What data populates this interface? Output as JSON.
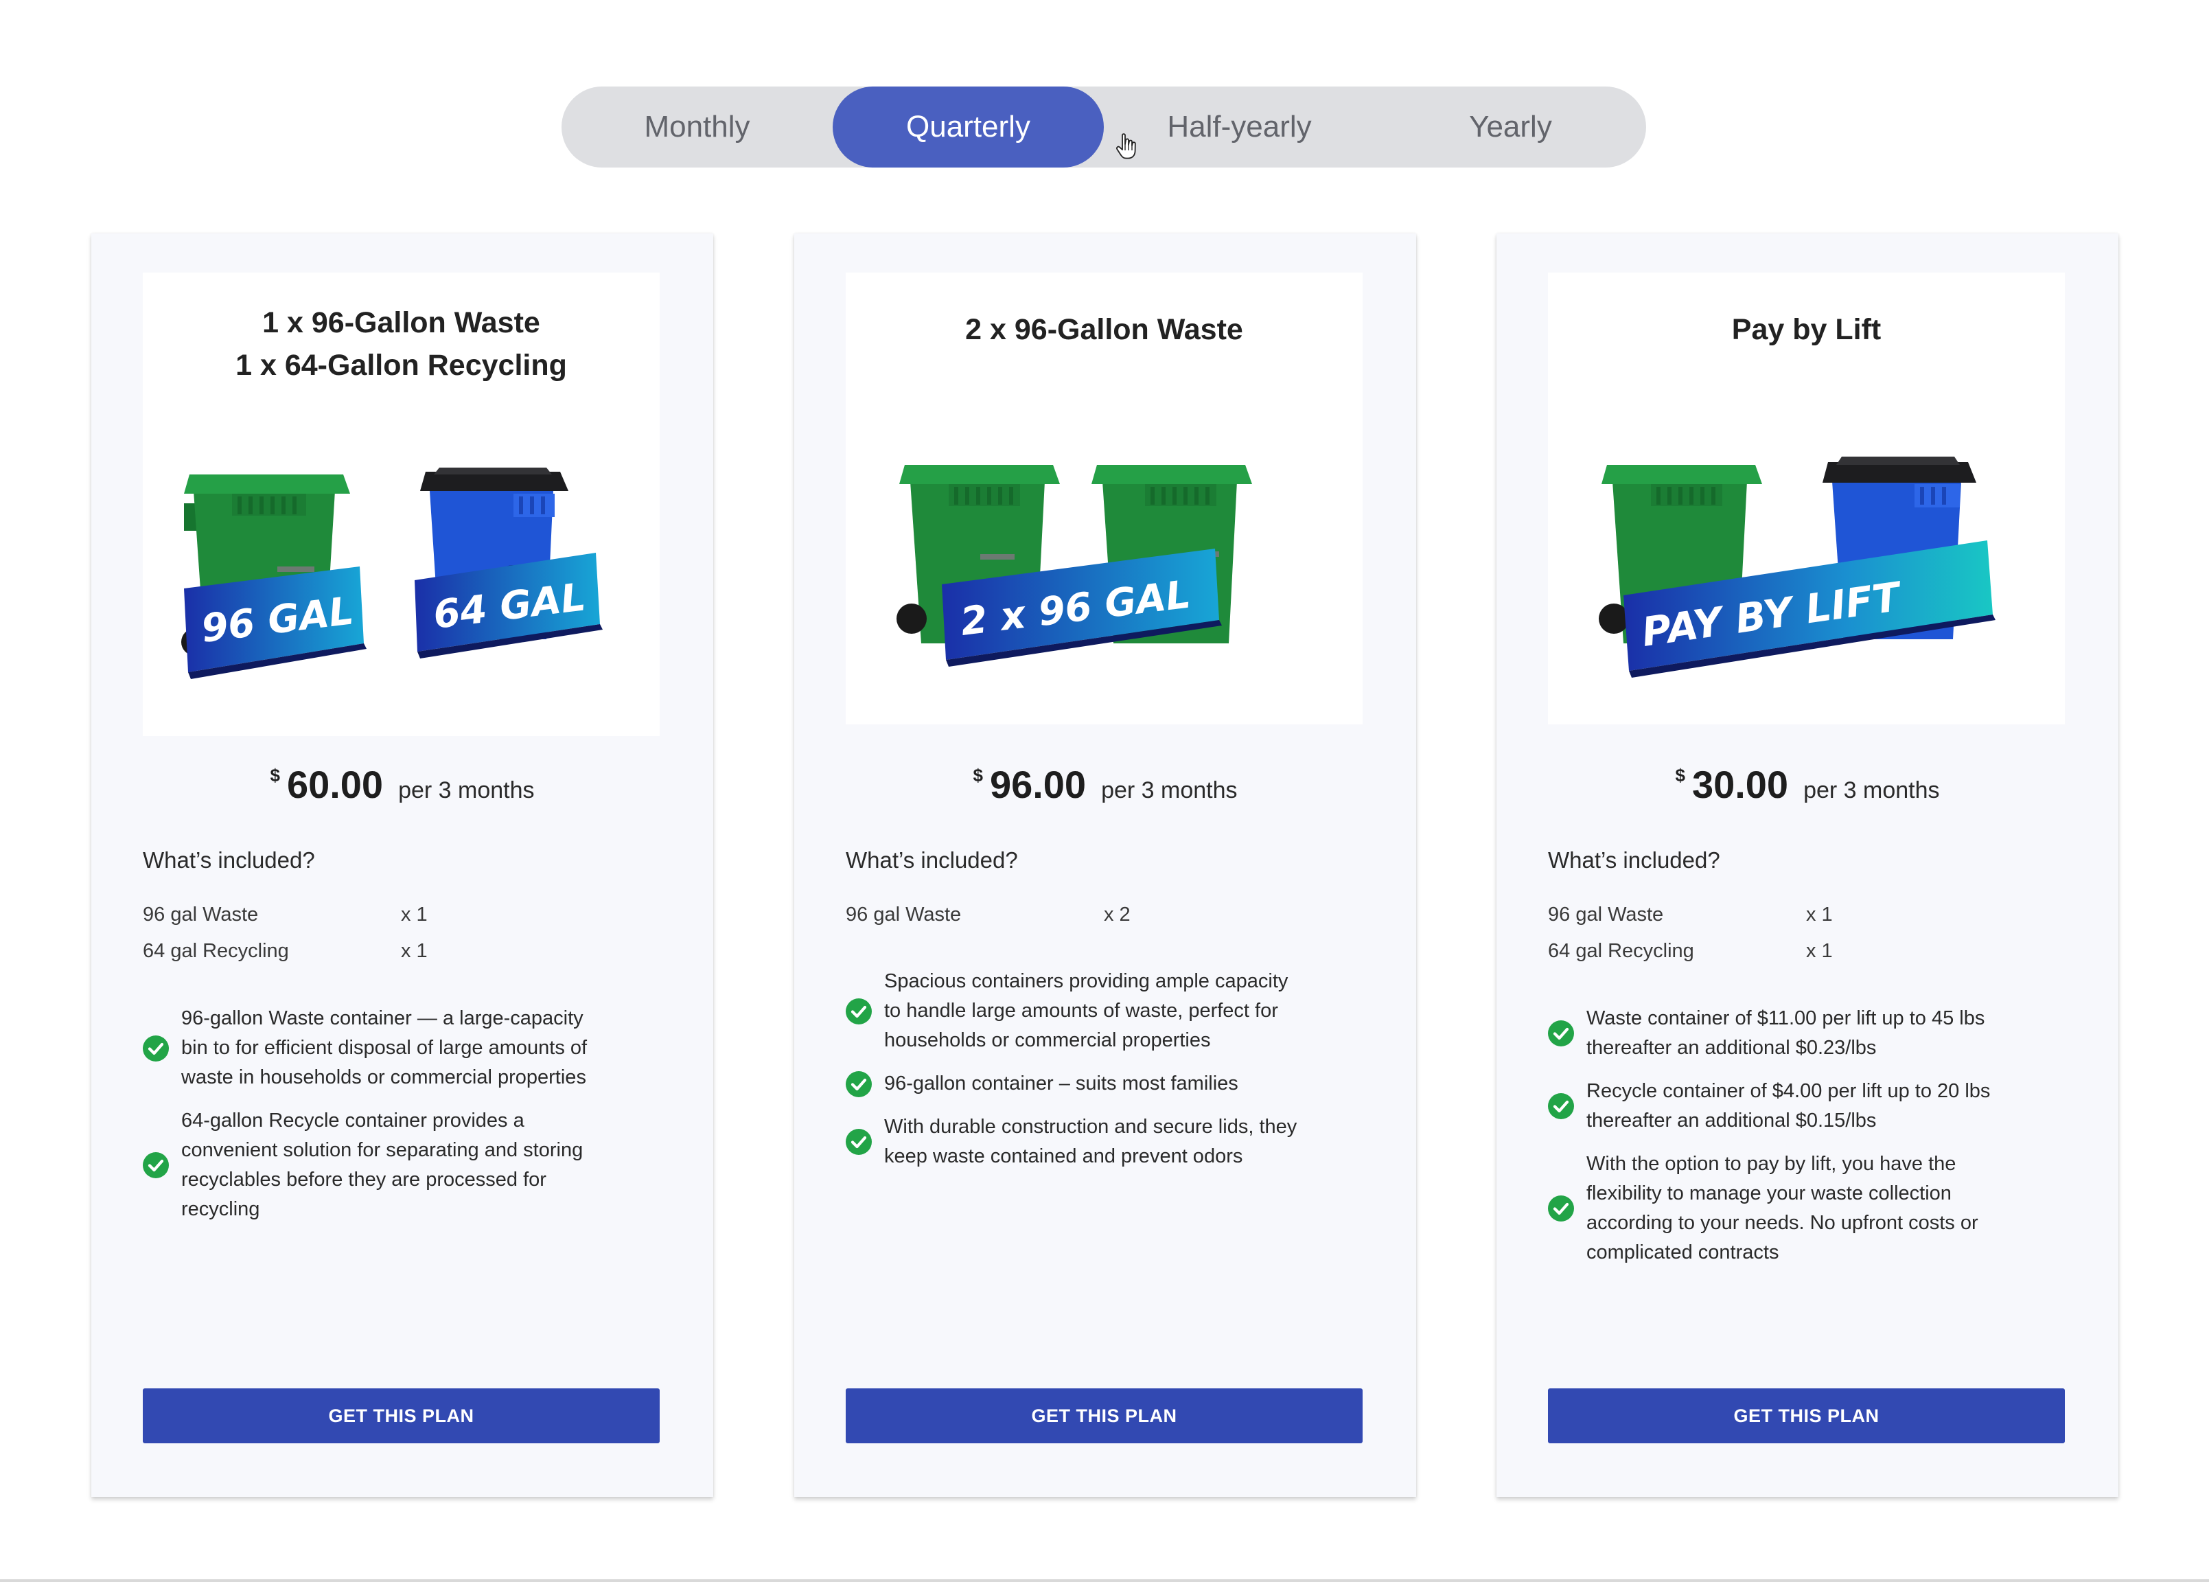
{
  "billing_toggle": {
    "options": [
      "Monthly",
      "Quarterly",
      "Half-yearly",
      "Yearly"
    ],
    "selected": "Quarterly"
  },
  "colors": {
    "accent": "#4a60c0",
    "button": "#3249b2",
    "toggle_bg": "#dedfe2",
    "check": "#22a447",
    "bin_green": "#1f8a3a",
    "bin_blue": "#1f55d6"
  },
  "plans": [
    {
      "title_line1": "1 x 96-Gallon Waste",
      "title_line2": "1 x 64-Gallon Recycling",
      "image_labels": [
        "96 GAL",
        "64 GAL"
      ],
      "currency": "$",
      "price": "60.00",
      "period": "per 3 months",
      "included_heading": "What’s included?",
      "quantities": [
        {
          "name": "96 gal Waste",
          "qty": "x 1"
        },
        {
          "name": "64 gal Recycling",
          "qty": "x 1"
        }
      ],
      "features": [
        {
          "line1": "96-gallon Waste container — a large-capacity",
          "line2": "bin to for efficient disposal of large amounts of",
          "line3": "waste in households or commercial properties",
          "line4": ""
        },
        {
          "line1": "64-gallon Recycle container provides a",
          "line2": "convenient solution for separating and storing",
          "line3": "recyclables before they are processed for",
          "line4": "recycling"
        }
      ],
      "cta": "GET THIS PLAN"
    },
    {
      "title_line1": "2 x 96-Gallon Waste",
      "title_line2": "",
      "image_labels": [
        "2 x 96 GAL"
      ],
      "currency": "$",
      "price": "96.00",
      "period": "per 3 months",
      "included_heading": "What’s included?",
      "quantities": [
        {
          "name": "96 gal Waste",
          "qty": "x 2"
        }
      ],
      "features": [
        {
          "line1": "Spacious containers providing ample capacity",
          "line2": "to handle large amounts of waste, perfect for",
          "line3": "households or commercial properties",
          "line4": ""
        },
        {
          "line1": "96-gallon container – suits most families",
          "line2": "",
          "line3": "",
          "line4": ""
        },
        {
          "line1": "With durable construction and secure lids, they",
          "line2": "keep waste contained and prevent odors",
          "line3": "",
          "line4": ""
        }
      ],
      "cta": "GET THIS PLAN"
    },
    {
      "title_line1": "Pay by Lift",
      "title_line2": "",
      "image_labels": [
        "PAY BY LIFT"
      ],
      "currency": "$",
      "price": "30.00",
      "period": "per 3 months",
      "included_heading": "What’s included?",
      "quantities": [
        {
          "name": "96 gal Waste",
          "qty": "x 1"
        },
        {
          "name": "64 gal Recycling",
          "qty": "x 1"
        }
      ],
      "features": [
        {
          "line1": "Waste container of $11.00 per lift up to 45 lbs",
          "line2": "thereafter an additional $0.23/lbs",
          "line3": "",
          "line4": ""
        },
        {
          "line1": "Recycle container of $4.00 per lift up to 20 lbs",
          "line2": "thereafter an additional $0.15/lbs",
          "line3": "",
          "line4": ""
        },
        {
          "line1": "With the option to pay by lift, you have the",
          "line2": "flexibility to manage your waste collection",
          "line3": "according to your needs. No upfront costs or",
          "line4": "complicated contracts"
        }
      ],
      "cta": "GET THIS PLAN"
    }
  ]
}
